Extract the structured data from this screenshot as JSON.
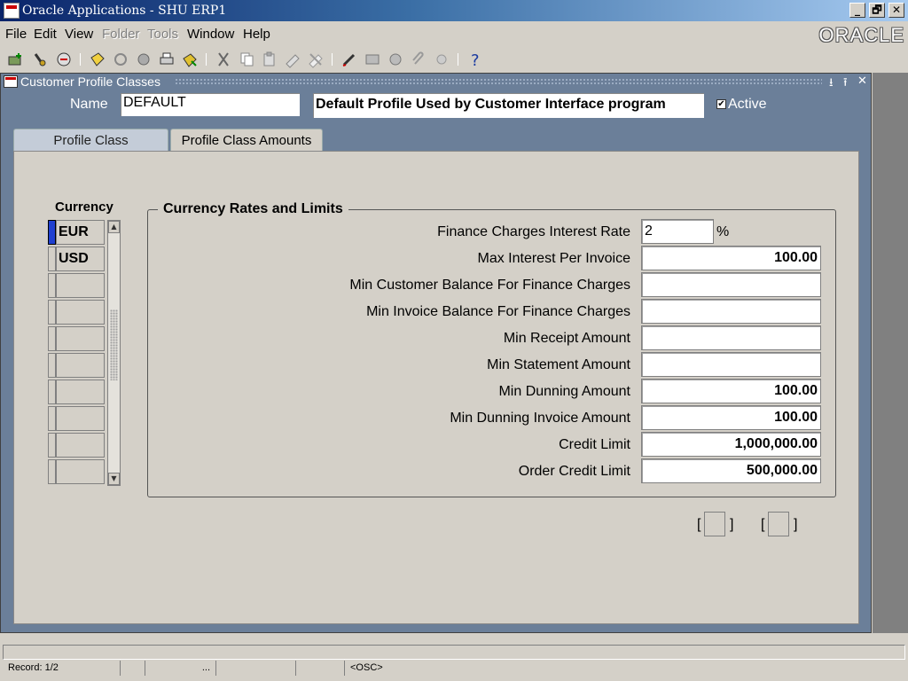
{
  "app": {
    "title": "Oracle Applications - SHU ERP1",
    "logo": "ORACLE",
    "window_buttons": [
      "_",
      "🗗",
      "✕"
    ]
  },
  "menu": [
    {
      "label": "File",
      "enabled": true
    },
    {
      "label": "Edit",
      "enabled": true
    },
    {
      "label": "View",
      "enabled": true
    },
    {
      "label": "Folder",
      "enabled": false
    },
    {
      "label": "Tools",
      "enabled": false
    },
    {
      "label": "Window",
      "enabled": true
    },
    {
      "label": "Help",
      "enabled": true
    }
  ],
  "toolbar": {
    "icons": [
      "new-icon",
      "find-icon",
      "navigator-icon",
      "save-icon",
      "next-step-icon",
      "switch-responsibility-icon",
      "print-icon",
      "close-form-icon",
      "cut-icon",
      "copy-icon",
      "paste-icon",
      "clear-record-icon",
      "delete-record-icon",
      "edit-field-icon",
      "zoom-icon",
      "translations-icon",
      "attachments-icon",
      "folder-tools-icon",
      "help-icon"
    ]
  },
  "form": {
    "title": "Customer Profile Classes",
    "name_label": "Name",
    "name_value": "DEFAULT",
    "description": "Default Profile Used by Customer Interface program",
    "active_label": "Active",
    "active_checked": true,
    "active_mark": "✔",
    "tabs": [
      {
        "label": "Profile Class",
        "active": false
      },
      {
        "label": "Profile Class Amounts",
        "active": true
      }
    ]
  },
  "currency": {
    "header": "Currency",
    "rows": [
      "EUR",
      "USD",
      "",
      "",
      "",
      "",
      "",
      "",
      "",
      ""
    ],
    "current_row": 0,
    "scroll_up": "▲",
    "scroll_down": "▼"
  },
  "rates": {
    "group_title": "Currency Rates and Limits",
    "percent_sign": "%",
    "fields": [
      {
        "label": "Finance Charges Interest Rate",
        "value": "2"
      },
      {
        "label": "Max Interest Per Invoice",
        "value": "100.00"
      },
      {
        "label": "Min Customer Balance For Finance Charges",
        "value": ""
      },
      {
        "label": "Min Invoice Balance For Finance Charges",
        "value": ""
      },
      {
        "label": "Min Receipt Amount",
        "value": ""
      },
      {
        "label": "Min Statement Amount",
        "value": ""
      },
      {
        "label": "Min Dunning Amount",
        "value": "100.00"
      },
      {
        "label": "Min Dunning Invoice Amount",
        "value": "100.00"
      },
      {
        "label": "Credit Limit",
        "value": "1,000,000.00"
      },
      {
        "label": "Order Credit Limit",
        "value": "500,000.00"
      }
    ]
  },
  "brackets": {
    "open": "[",
    "close": "]"
  },
  "status": {
    "record": "Record: 1/2",
    "ellipsis": "...",
    "osc": "<OSC>"
  }
}
